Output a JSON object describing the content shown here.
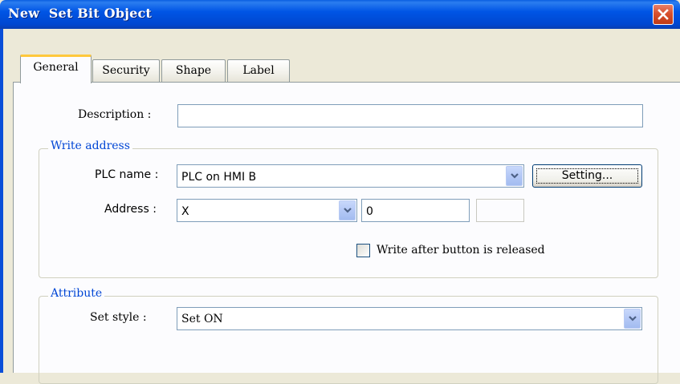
{
  "window": {
    "title": "New  Set Bit Object",
    "close_icon": "close-icon"
  },
  "tabs": [
    {
      "label": "General",
      "active": true
    },
    {
      "label": "Security",
      "active": false
    },
    {
      "label": "Shape",
      "active": false
    },
    {
      "label": "Label",
      "active": false
    }
  ],
  "general": {
    "description_label": "Description :",
    "description_value": "",
    "write_address": {
      "group_title": "Write address",
      "plc_name_label": "PLC name :",
      "plc_name_value": "PLC on HMI B",
      "setting_button": "Setting...",
      "address_label": "Address :",
      "address_device": "X",
      "address_value": "0",
      "write_after_release_label": "Write after button is released",
      "write_after_release_checked": false
    },
    "attribute": {
      "group_title": "Attribute",
      "set_style_label": "Set style :",
      "set_style_value": "Set ON"
    }
  },
  "colors": {
    "titlebar": "#0055e5",
    "group_title": "#0046d5",
    "tab_highlight": "#ffc83c"
  }
}
